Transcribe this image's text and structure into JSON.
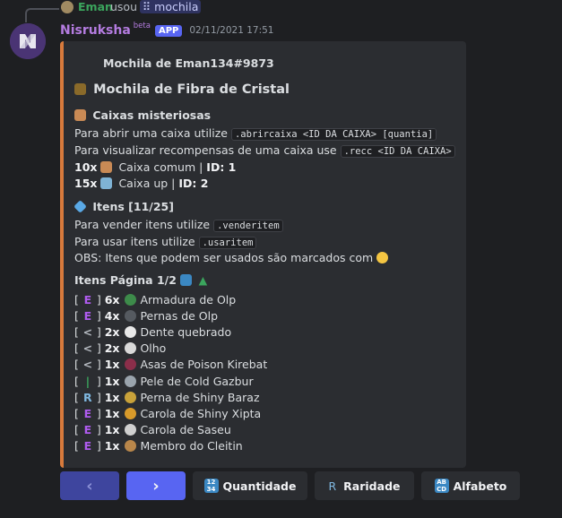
{
  "reply": {
    "user": "Eman",
    "used": "usou",
    "command": "mochila"
  },
  "message": {
    "author": "Nisruksha",
    "beta": "beta",
    "app_badge": "APP",
    "timestamp": "02/11/2021 17:51"
  },
  "embed": {
    "author": "Mochila de Eman134#9873",
    "title": "Mochila de Fibra de Cristal",
    "boxes": {
      "heading": "Caixas misteriosas",
      "open_text": "Para abrir uma caixa utilize",
      "open_cmd": ".abrircaixa <ID DA CAIXA> [quantia]",
      "view_text": "Para visualizar recompensas de uma caixa use",
      "view_cmd": ".recc <ID DA CAIXA>",
      "list": [
        {
          "qty": "10x",
          "name": "Caixa comum |",
          "id": "ID: 1"
        },
        {
          "qty": "15x",
          "name": "Caixa up |",
          "id": "ID: 2"
        }
      ]
    },
    "items": {
      "heading": "Itens [11/25]",
      "sell_text": "Para vender itens utilize",
      "sell_cmd": ".venderitem",
      "use_text": "Para usar itens utilize",
      "use_cmd": ".usaritem",
      "obs_text": "OBS: Itens que podem ser usados são marcados com",
      "page_heading": "Itens Página 1/2",
      "list": [
        {
          "rarity": "E",
          "qty": "6x",
          "name": "Armadura de Olp"
        },
        {
          "rarity": "E",
          "qty": "4x",
          "name": "Pernas de Olp"
        },
        {
          "rarity": "<",
          "qty": "2x",
          "name": "Dente quebrado"
        },
        {
          "rarity": "<",
          "qty": "2x",
          "name": "Olho"
        },
        {
          "rarity": "<",
          "qty": "1x",
          "name": "Asas de Poison Kirebat"
        },
        {
          "rarity": "|",
          "qty": "1x",
          "name": "Pele de Cold Gazbur"
        },
        {
          "rarity": "R",
          "qty": "1x",
          "name": "Perna de Shiny Baraz"
        },
        {
          "rarity": "E",
          "qty": "1x",
          "name": "Carola de Shiny Xipta"
        },
        {
          "rarity": "E",
          "qty": "1x",
          "name": "Carola de Saseu"
        },
        {
          "rarity": "E",
          "qty": "1x",
          "name": "Membro do Cleitin"
        }
      ]
    }
  },
  "buttons": {
    "prev": "‹",
    "next": "›",
    "quantity": "Quantidade",
    "rarity_icon": "R",
    "rarity": "Raridade",
    "alphabet": "Alfabeto"
  },
  "colors": {
    "accent": "#d77a3c",
    "blurple": "#5865f2",
    "author": "#b47ce0",
    "reply_user": "#3ba55d"
  },
  "icons": [
    "reply-spine",
    "treasure-chest-icon",
    "mystery-box-icon",
    "diamond-icon",
    "sparkle-icon",
    "numbers-keycap-icon",
    "up-arrow-icon",
    "abcd-keycap-icon"
  ]
}
